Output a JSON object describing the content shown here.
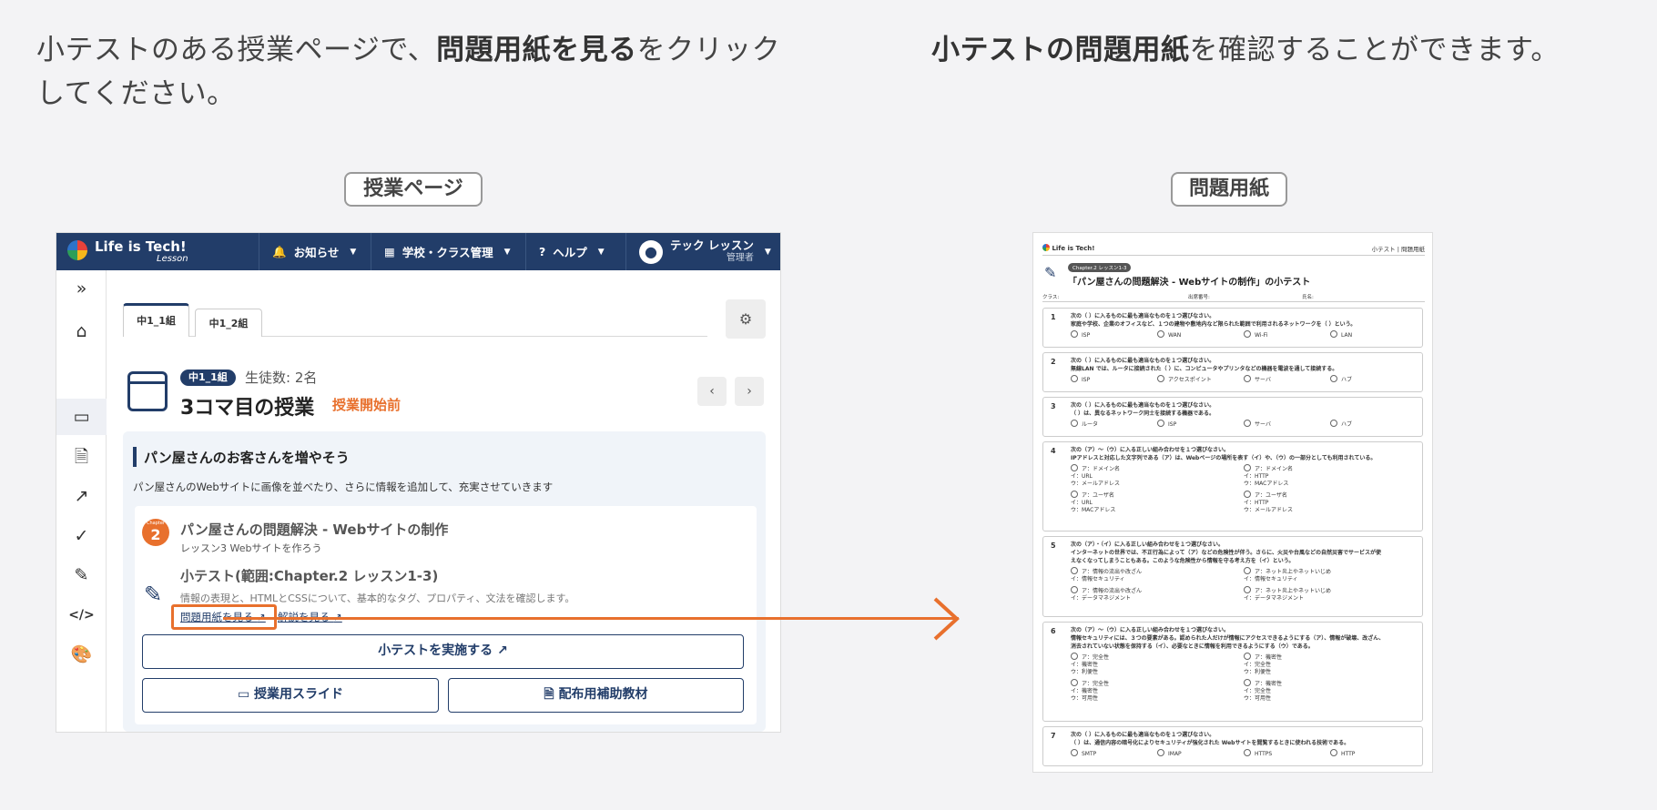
{
  "left_caption": {
    "pre": "小テストのある授業ページで、",
    "bold": "問題用紙を見る",
    "post": "をクリック",
    "line2": "してください。"
  },
  "right_caption": {
    "bold": "小テストの問題用紙",
    "post": "を確認することができます。"
  },
  "left_label": "授業ページ",
  "right_label": "問題用紙",
  "app": {
    "logo": "Life is Tech!",
    "logo_sub": "Lesson",
    "nav": [
      "お知らせ",
      "学校・クラス管理",
      "ヘルプ"
    ],
    "user_name": "テック レッスン",
    "user_role": "管理者",
    "tabs": [
      "中1_1組",
      "中1_2組"
    ],
    "class_badge": "中1_1組",
    "student_count": "生徒数: 2名",
    "lesson_title": "3コマ目の授業",
    "lesson_status": "授業開始前",
    "section_title": "パン屋さんのお客さんを増やそう",
    "section_desc": "パン屋さんのWebサイトに画像を並べたり、さらに情報を追加して、充実させていきます",
    "chapter_label": "Chapter",
    "chapter_num": "2",
    "chapter_title": "パン屋さんの問題解決 - Webサイトの制作",
    "lesson_sub": "レッスン3  Webサイトを作ろう",
    "quiz_title": "小テスト(範囲:Chapter.2 レッスン1-3)",
    "quiz_desc": "情報の表現と、HTMLとCSSについて、基本的なタグ、プロパティ、文法を確認します。",
    "view_sheet": "問題用紙を見る",
    "view_answer": "解説を見る",
    "run_quiz": "小テストを実施する",
    "slides": "授業用スライド",
    "materials": "配布用補助教材",
    "colors": {
      "navy": "#223d69",
      "orange": "#e8702d"
    }
  },
  "paper": {
    "logo": "Life is Tech!",
    "header_right": "小テスト | 問題用紙",
    "chapter_badge": "Chapter.2 レッスン1-3",
    "title": "「パン屋さんの問題解決 - Webサイトの制作」の小テスト",
    "fields": [
      "クラス:",
      "出席番号:",
      "氏名:"
    ],
    "questions": [
      {
        "n": "1",
        "text": "次の（ ）に入るものに最も適当なものを１つ選びなさい。\n家庭や学校、企業のオフィスなど、１つの建物や敷地内など限られた範囲で利用されるネットワークを（ ）という。",
        "options": [
          "ISP",
          "WAN",
          "Wi-Fi",
          "LAN"
        ]
      },
      {
        "n": "2",
        "text": "次の（ ）に入るものに最も適当なものを１つ選びなさい。\n無線LAN では、ルータに接続された（ ）に、コンピュータやプリンタなどの機器を電波を通して接続する。",
        "options": [
          "ISP",
          "アクセスポイント",
          "サーバ",
          "ハブ"
        ]
      },
      {
        "n": "3",
        "text": "次の（ ）に入るものに最も適当なものを１つ選びなさい。\n（ ）は、異なるネットワーク同士を接続する機器である。",
        "options": [
          "ルータ",
          "ISP",
          "サーバ",
          "ハブ"
        ]
      },
      {
        "n": "4",
        "text": "次の（ア）～（ウ）に入る正しい組み合わせを１つ選びなさい。\nIPアドレスと対応した文字列である（ア）は、Webページの場所を表す（イ）や、（ウ）の一部分としても利用されている。",
        "options": [
          "ア：ドメイン名\nイ：URL\nウ：メールアドレス",
          "ア：ドメイン名\nイ：HTTP\nウ：MACアドレス",
          "ア：ユーザ名\nイ：URL\nウ：MACアドレス",
          "ア：ユーザ名\nイ：HTTP\nウ：メールアドレス"
        ]
      },
      {
        "n": "5",
        "text": "次の（ア）・（イ）に入る正しい組み合わせを１つ選びなさい。\nインターネットの世界では、不正行為によって（ア）などの危険性が伴う。さらに、火災や台風などの自然災害でサービスが使\nえなくなってしまうこともある。このような危険性から情報を守る考え方を（イ）という。",
        "options": [
          "ア：情報の流出や改ざん\nイ：情報セキュリティ",
          "ア：ネット炎上やネットいじめ\nイ：情報セキュリティ",
          "ア：情報の流出や改ざん\nイ：データマネジメント",
          "ア：ネット炎上やネットいじめ\nイ：データマネジメント"
        ]
      },
      {
        "n": "6",
        "text": "次の（ア）～（ウ）に入る正しい組み合わせを１つ選びなさい。\n情報セキュリティには、３つの要素がある。認められた人だけが情報にアクセスできるようにする（ア）、情報が破壊、改ざん、\n消去されていない状態を保持する（イ）、必要なときに情報を利用できるようにする（ウ）である。",
        "options": [
          "ア：完全性\nイ：機密性\nウ：利便性",
          "ア：機密性\nイ：完全性\nウ：利便性",
          "ア：完全性\nイ：機密性\nウ：可用性",
          "ア：機密性\nイ：完全性\nウ：可用性"
        ]
      },
      {
        "n": "7",
        "text": "次の（ ）に入るものに最も適当なものを１つ選びなさい。\n（ ）は、通信内容の暗号化によりセキュリティが強化された Webサイトを閲覧するときに使われる技術である。",
        "options": [
          "SMTP",
          "IMAP",
          "HTTPS",
          "HTTP"
        ]
      }
    ]
  }
}
